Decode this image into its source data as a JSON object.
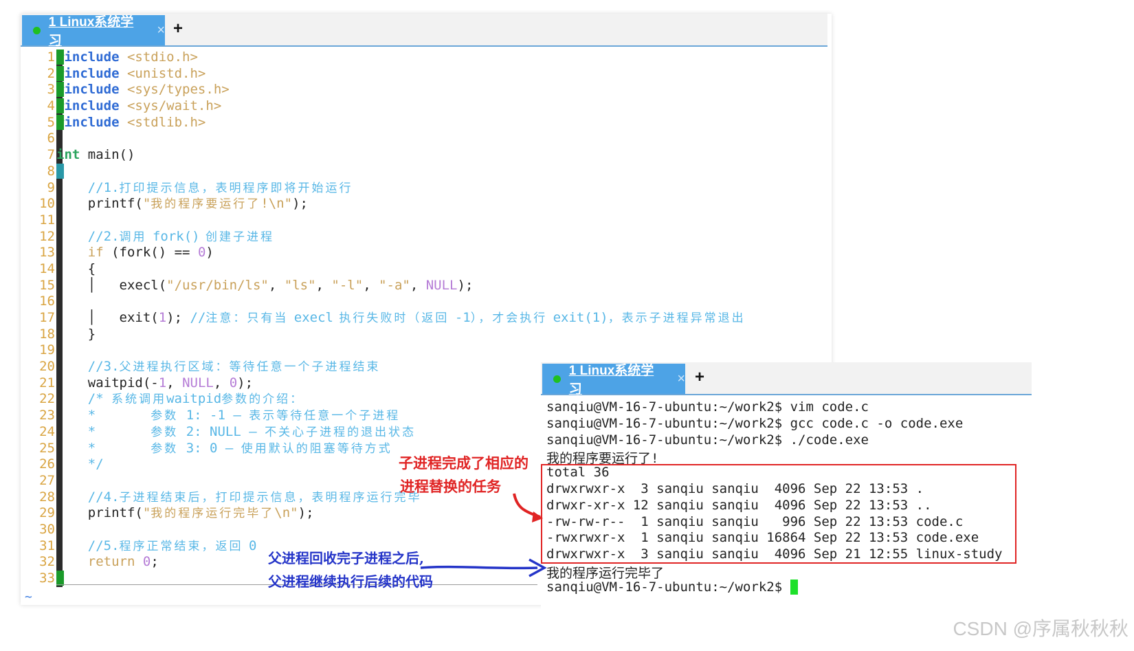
{
  "editor": {
    "tab_title": "1 Linux系统学习",
    "tab_close": "×",
    "tab_add": "+",
    "line_numbers": [
      "1",
      "2",
      "3",
      "4",
      "5",
      "6",
      "7",
      "8",
      "9",
      "10",
      "11",
      "12",
      "13",
      "14",
      "15",
      "16",
      "17",
      "18",
      "19",
      "20",
      "21",
      "22",
      "23",
      "24",
      "25",
      "26",
      "27",
      "28",
      "29",
      "30",
      "31",
      "32",
      "33"
    ],
    "tilde": "~"
  },
  "terminal": {
    "tab_title": "1 Linux系统学习",
    "tab_close": "×",
    "tab_add": "+",
    "lines": [
      "sanqiu@VM-16-7-ubuntu:~/work2$ vim code.c",
      "sanqiu@VM-16-7-ubuntu:~/work2$ gcc code.c -o code.exe",
      "sanqiu@VM-16-7-ubuntu:~/work2$ ./code.exe",
      "我的程序要运行了!",
      "total 36",
      "drwxrwxr-x  3 sanqiu sanqiu  4096 Sep 22 13:53 .",
      "drwxr-xr-x 12 sanqiu sanqiu  4096 Sep 22 13:53 ..",
      "-rw-rw-r--  1 sanqiu sanqiu   996 Sep 22 13:53 code.c",
      "-rwxrwxr-x  1 sanqiu sanqiu 16864 Sep 22 13:53 code.exe",
      "drwxrwxr-x  3 sanqiu sanqiu  4096 Sep 21 12:55 linux-study",
      "我的程序运行完毕了",
      "sanqiu@VM-16-7-ubuntu:~/work2$ "
    ]
  },
  "annotations": {
    "red_1": "子进程完成了相应的",
    "red_2": "进程替换的任务",
    "blue_1": "父进程回收完子进程之后,",
    "blue_2": "父进程继续执行后续的代码"
  },
  "watermark": "CSDN @序属秋秋秋",
  "colors": {
    "tab": "#4da3e6",
    "line_number": "#d9a441",
    "comment": "#58b7e6",
    "keyword": "#2f6bd4",
    "highlight_box": "#e02424",
    "cursor": "#1ee02a"
  }
}
